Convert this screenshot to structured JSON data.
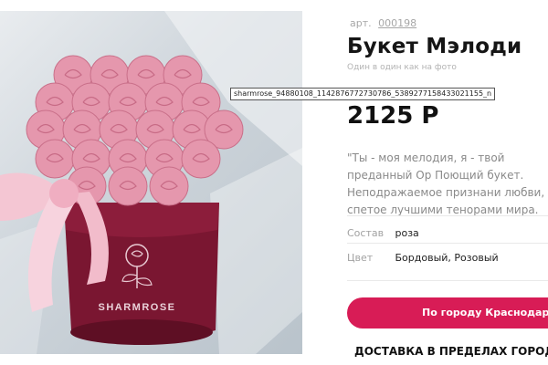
{
  "product": {
    "sku_label": "арт.",
    "sku_number": "000198",
    "title": "Букет Мэлоди",
    "subtitle": "Один в один как на фото",
    "price": "2125 Р",
    "description": "\"Ты - моя мелодия, я - твой преданный Ор Поющий букет. Неподражаемое признани любви, спетое лучшими тенорами мира.",
    "attributes": [
      {
        "label": "Состав",
        "value": "роза"
      },
      {
        "label": "Цвет",
        "value": "Бордовый, Розовый"
      }
    ]
  },
  "photo": {
    "box_brand": "SHARMROSE",
    "tooltip": "sharmrose_94880108_1142876772730786_5389277158433021155_n"
  },
  "actions": {
    "city_button": "По городу Краснодар",
    "delivery_heading": "ДОСТАВКА В ПРЕДЕЛАХ ГОРОДА"
  },
  "colors": {
    "accent": "#d81c56",
    "box": "#7a1631",
    "rose": "#e597ad",
    "ribbon": "#f4c6d3"
  },
  "icons": {
    "box_logo": "rose-logo-icon"
  }
}
